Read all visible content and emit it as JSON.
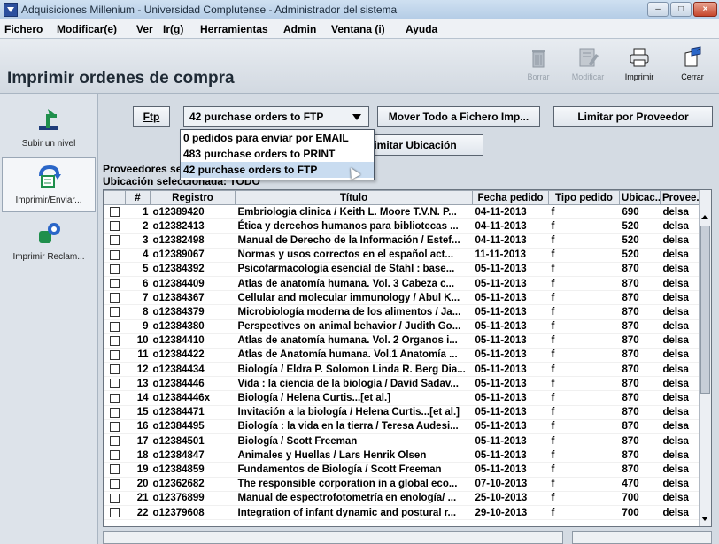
{
  "window": {
    "title": "Adquisiciones Millenium - Universidad Complutense - Administrador del sistema",
    "minimize": "–",
    "maximize": "□",
    "close": "×"
  },
  "menu": [
    "Fichero",
    "Modificar(e)",
    "Ver",
    "Ir(g)",
    "Herramientas",
    "Admin",
    "Ventana (i)",
    "Ayuda"
  ],
  "page_title": "Imprimir ordenes de compra",
  "toolbar": {
    "borrar": "Borrar",
    "modificar": "Modificar",
    "imprimir": "Imprimir",
    "cerrar": "Cerrar"
  },
  "nav": {
    "subir": "Subir un nivel",
    "imprimir_enviar": "Imprimir/Enviar...",
    "imprimir_reclam": "Imprimir Reclam..."
  },
  "controls": {
    "ftp_button": "Ftp",
    "combo_value": "42 purchase orders to FTP",
    "mover_button": "Mover Todo a Fichero Imp...",
    "limitar_proveedor_button": "Limitar por Proveedor",
    "limitar_ubicacion_button": "imitar Ubicación",
    "dropdown_options": [
      "0  pedidos para enviar por EMAIL",
      "483 purchase orders to PRINT",
      "42 purchase orders to FTP"
    ]
  },
  "info": {
    "proveedores": "Proveedores se",
    "ubicacion": "Ubicación seleccionada: TODO"
  },
  "table": {
    "headers": [
      "",
      "#",
      "Registro",
      "Título",
      "Fecha pedido",
      "Tipo pedido",
      "Ubicac...",
      "Provee..."
    ],
    "rows": [
      [
        "1",
        "o12389420",
        "Embriologia clinica / Keith L. Moore T.V.N. P...",
        "04-11-2013",
        "f",
        "690",
        "delsa"
      ],
      [
        "2",
        "o12382413",
        "Ética y derechos humanos para bibliotecas ...",
        "04-11-2013",
        "f",
        "520",
        "delsa"
      ],
      [
        "3",
        "o12382498",
        "Manual de Derecho de la Información / Estef...",
        "04-11-2013",
        "f",
        "520",
        "delsa"
      ],
      [
        "4",
        "o12389067",
        "Normas y usos correctos en el español act...",
        "11-11-2013",
        "f",
        "520",
        "delsa"
      ],
      [
        "5",
        "o12384392",
        "Psicofarmacología esencial de Stahl : base...",
        "05-11-2013",
        "f",
        "870",
        "delsa"
      ],
      [
        "6",
        "o12384409",
        "Atlas de anatomía humana. Vol. 3 Cabeza c...",
        "05-11-2013",
        "f",
        "870",
        "delsa"
      ],
      [
        "7",
        "o12384367",
        "Cellular and molecular immunology / Abul K...",
        "05-11-2013",
        "f",
        "870",
        "delsa"
      ],
      [
        "8",
        "o12384379",
        "Microbiología moderna de los alimentos / Ja...",
        "05-11-2013",
        "f",
        "870",
        "delsa"
      ],
      [
        "9",
        "o12384380",
        "Perspectives on animal behavior / Judith Go...",
        "05-11-2013",
        "f",
        "870",
        "delsa"
      ],
      [
        "10",
        "o12384410",
        "Atlas de anatomía humana. Vol. 2 Organos i...",
        "05-11-2013",
        "f",
        "870",
        "delsa"
      ],
      [
        "11",
        "o12384422",
        "Atlas de Anatomía humana. Vol.1 Anatomía ...",
        "05-11-2013",
        "f",
        "870",
        "delsa"
      ],
      [
        "12",
        "o12384434",
        "Biología / Eldra P. Solomon Linda R. Berg Dia...",
        "05-11-2013",
        "f",
        "870",
        "delsa"
      ],
      [
        "13",
        "o12384446",
        "Vida : la ciencia de la biología / David Sadav...",
        "05-11-2013",
        "f",
        "870",
        "delsa"
      ],
      [
        "14",
        "o12384446x",
        "Biología / Helena Curtis...[et al.]",
        "05-11-2013",
        "f",
        "870",
        "delsa"
      ],
      [
        "15",
        "o12384471",
        "Invitación a la biología / Helena Curtis...[et al.]",
        "05-11-2013",
        "f",
        "870",
        "delsa"
      ],
      [
        "16",
        "o12384495",
        "Biología : la vida en la tierra / Teresa Audesi...",
        "05-11-2013",
        "f",
        "870",
        "delsa"
      ],
      [
        "17",
        "o12384501",
        "Biología / Scott Freeman",
        "05-11-2013",
        "f",
        "870",
        "delsa"
      ],
      [
        "18",
        "o12384847",
        "Animales y Huellas / Lars Henrik Olsen",
        "05-11-2013",
        "f",
        "870",
        "delsa"
      ],
      [
        "19",
        "o12384859",
        "Fundamentos de Biología / Scott Freeman",
        "05-11-2013",
        "f",
        "870",
        "delsa"
      ],
      [
        "20",
        "o12362682",
        "The responsible corporation in a global eco...",
        "07-10-2013",
        "f",
        "470",
        "delsa"
      ],
      [
        "21",
        "o12376899",
        "Manual de espectrofotometría en enología/ ...",
        "25-10-2013",
        "f",
        "700",
        "delsa"
      ],
      [
        "22",
        "o12379608",
        "Integration of infant dynamic and postural r...",
        "29-10-2013",
        "f",
        "700",
        "delsa"
      ]
    ]
  }
}
